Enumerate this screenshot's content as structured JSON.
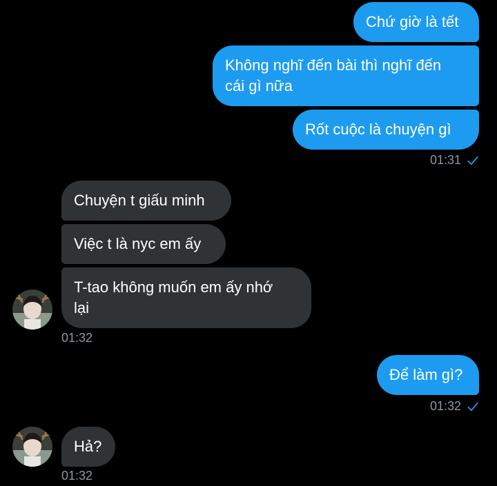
{
  "conversation": {
    "outgoing_group_1": {
      "messages": [
        "Chứ giờ là tết",
        "Không nghĩ đến bài thì nghĩ đến\ncái gì nữa",
        "Rốt cuộc là chuyện gì"
      ],
      "time": "01:31"
    },
    "incoming_group_1": {
      "messages": [
        "Chuyện t giấu minh",
        "Việc t là nyc em ấy",
        "T-tao không muốn em ấy nhớ\nlại"
      ],
      "time": "01:32"
    },
    "outgoing_group_2": {
      "messages": [
        "Để làm gì?"
      ],
      "time": "01:32"
    },
    "incoming_group_2": {
      "messages": [
        "Hả?"
      ],
      "time": "01:32"
    }
  },
  "colors": {
    "background": "#000000",
    "outgoing_bubble": "#1d9bf0",
    "incoming_bubble": "#2f3336",
    "timestamp": "#8b98a5",
    "read_check": "#1d9bf0"
  },
  "icons": {
    "read_status": "check-icon",
    "contact_avatar": "avatar"
  }
}
